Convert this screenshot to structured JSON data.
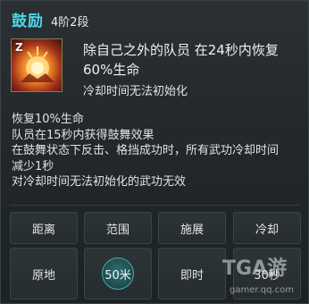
{
  "skill": {
    "name": "鼓励",
    "rank": "4阶2段",
    "main_desc": "除自己之外的队员 在24秒内恢复60%生命",
    "cooldown_note": "冷却时间无法初始化",
    "icon": "skill-encourage-icon",
    "icon_badge": "Z"
  },
  "effects": [
    "恢复10%生命",
    "队员在15秒内获得鼓舞效果",
    "在鼓舞状态下反击、格挡成功时，所有武功冷却时间",
    "减少1秒",
    "对冷却时间无法初始化的武功无效"
  ],
  "stats": {
    "headers": [
      "距离",
      "范围",
      "施展",
      "冷却"
    ],
    "values": [
      "原地",
      "50米",
      "即时",
      "30秒"
    ]
  },
  "watermark": {
    "logo_text": "TGA游",
    "url": "gamer.qq.com"
  },
  "colors": {
    "title_accent": "#4fd6e6",
    "range_circle": "#1d4a4d"
  }
}
